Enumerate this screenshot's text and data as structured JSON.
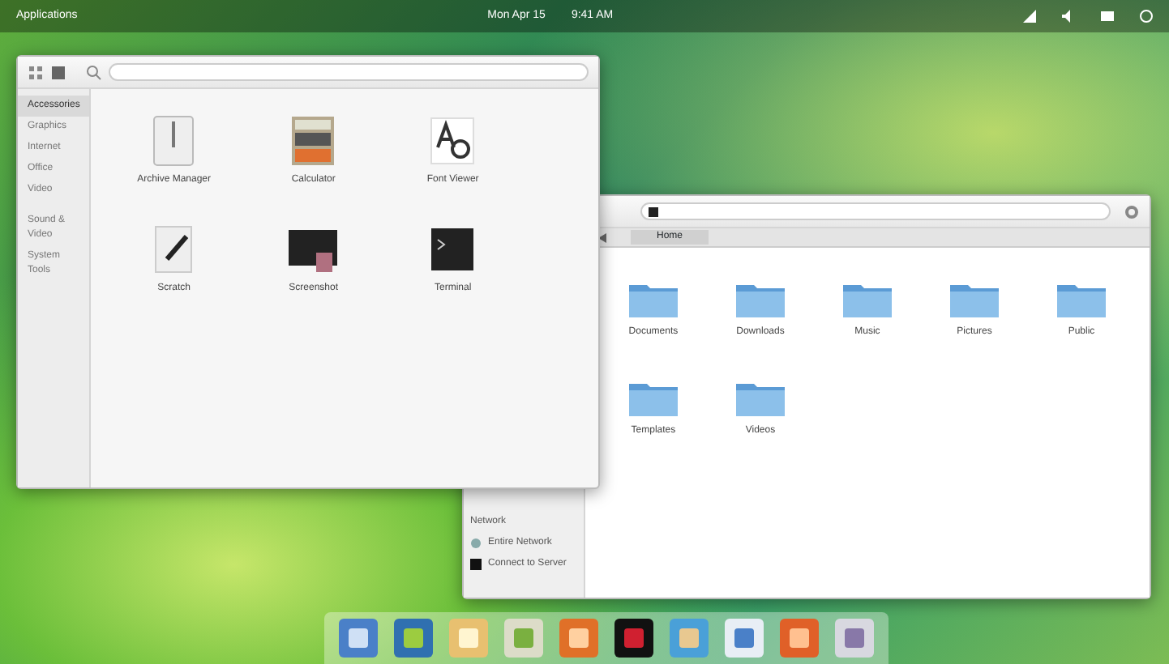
{
  "top_panel": {
    "menu": "Applications",
    "date": "Mon Apr 15",
    "time": "9:41 AM"
  },
  "launcher": {
    "categories": [
      {
        "label": "Accessories",
        "selected": true
      },
      {
        "label": "Graphics",
        "selected": false
      },
      {
        "label": "Internet",
        "selected": false
      },
      {
        "label": "Office",
        "selected": false
      },
      {
        "label": "Video",
        "selected": false
      },
      {
        "label": "Sound & Video",
        "selected": false
      },
      {
        "label": "System Tools",
        "selected": false
      }
    ],
    "apps": [
      {
        "name": "Archive Manager",
        "kind": "archive"
      },
      {
        "name": "Calculator",
        "kind": "calculator"
      },
      {
        "name": "Font Viewer",
        "kind": "font"
      },
      {
        "name": "Scratch",
        "kind": "editor"
      },
      {
        "name": "Screenshot",
        "kind": "screenshot"
      },
      {
        "name": "Terminal",
        "kind": "terminal"
      }
    ]
  },
  "files": {
    "path": "Home",
    "sidebar": {
      "heading": "Network",
      "items": [
        {
          "label": "Entire Network",
          "kind": "network"
        },
        {
          "label": "Connect to Server",
          "kind": "server"
        }
      ]
    },
    "folders": [
      "Documents",
      "Downloads",
      "Music",
      "Pictures",
      "Public",
      "Templates",
      "Videos"
    ]
  },
  "dock": [
    {
      "kind": "files"
    },
    {
      "kind": "browser"
    },
    {
      "kind": "mail"
    },
    {
      "kind": "calendar"
    },
    {
      "kind": "music"
    },
    {
      "kind": "video"
    },
    {
      "kind": "photos"
    },
    {
      "kind": "software"
    },
    {
      "kind": "store"
    },
    {
      "kind": "settings"
    }
  ]
}
